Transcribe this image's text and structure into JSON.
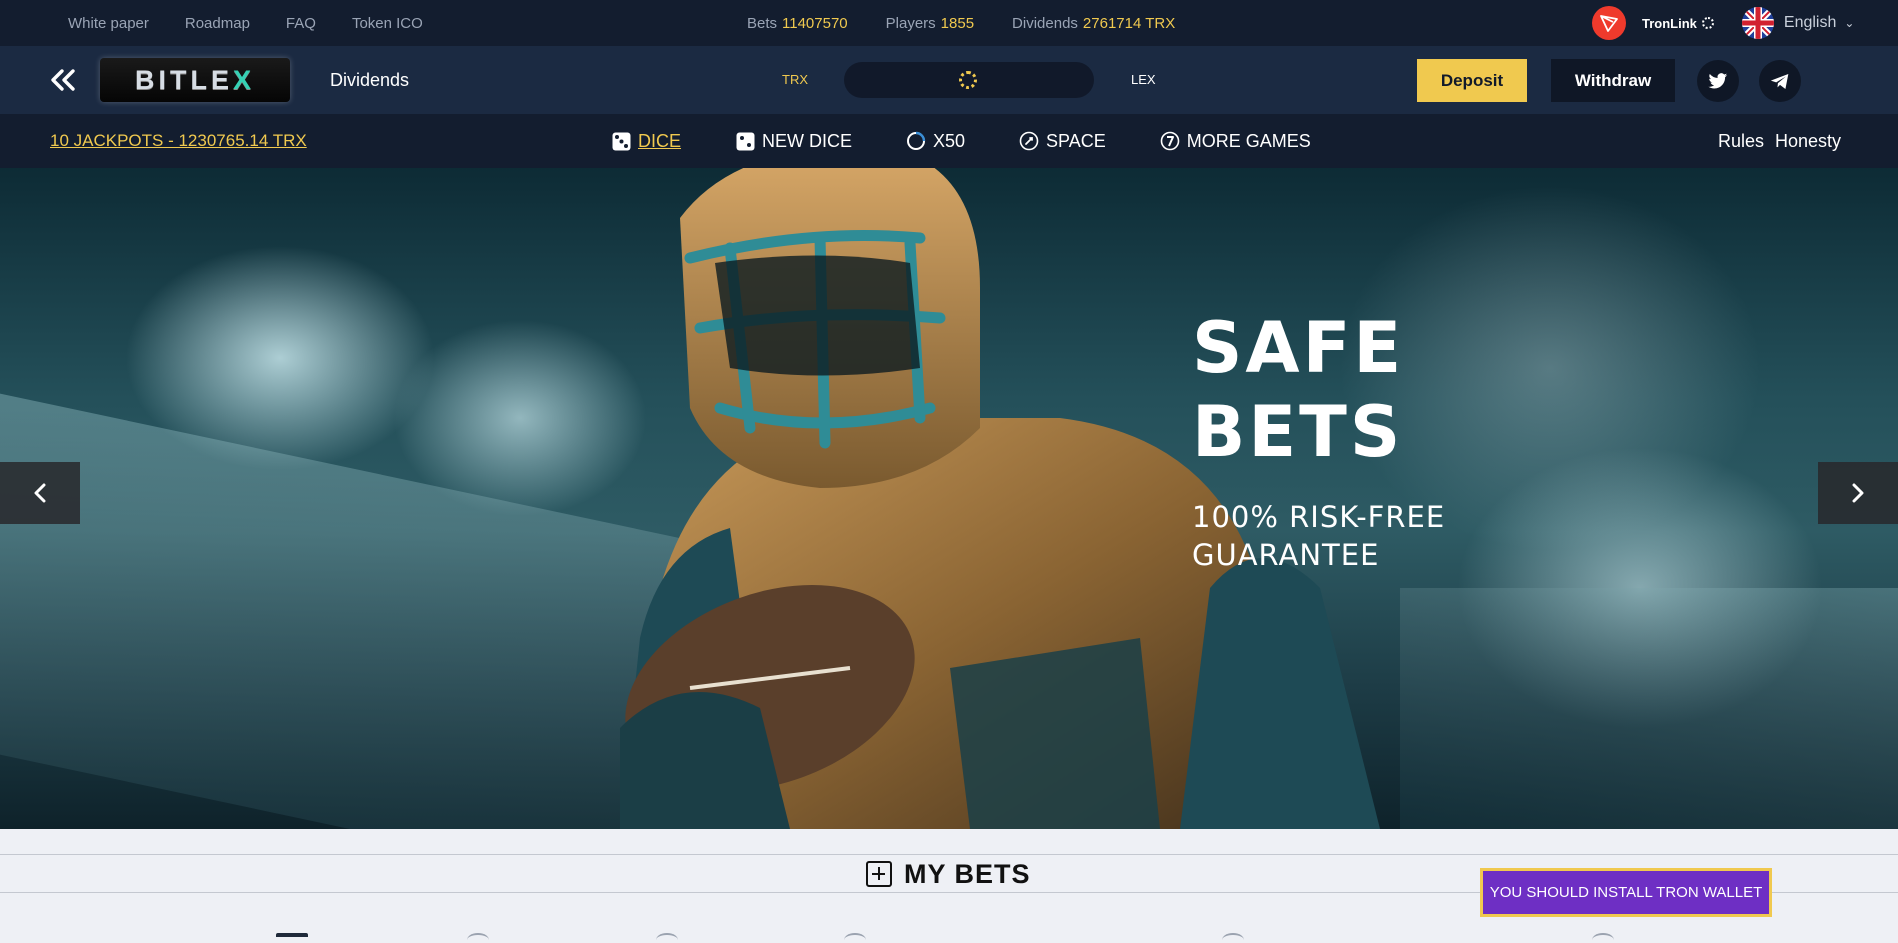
{
  "topbar": {
    "links": [
      "White paper",
      "Roadmap",
      "FAQ",
      "Token ICO"
    ],
    "stats": [
      {
        "label": "Bets",
        "value": "11407570"
      },
      {
        "label": "Players",
        "value": "1855"
      },
      {
        "label": "Dividends",
        "value": "2761714 TRX"
      }
    ],
    "wallet_label": "TronLink",
    "language": "English"
  },
  "header": {
    "logo_text": "BITLE",
    "logo_accent": "X",
    "dividends_label": "Dividends",
    "currency_left": "TRX",
    "currency_right": "LEX",
    "deposit_label": "Deposit",
    "withdraw_label": "Withdraw"
  },
  "nav": {
    "jackpot_text": "10 JACKPOTS - 1230765.14 TRX",
    "games": [
      {
        "label": "DICE",
        "icon": "dice-icon",
        "active": true
      },
      {
        "label": "NEW DICE",
        "icon": "new-dice-icon",
        "active": false
      },
      {
        "label": "X50",
        "icon": "wheel-icon",
        "active": false
      },
      {
        "label": "SPACE",
        "icon": "rocket-icon",
        "active": false
      },
      {
        "label": "MORE GAMES",
        "icon": "seven-icon",
        "active": false
      }
    ],
    "rules_label": "Rules",
    "honesty_label": "Honesty"
  },
  "hero": {
    "title_line1": "SAFE",
    "title_line2": "BETS",
    "subtitle_line1": "100% RISK-FREE",
    "subtitle_line2": "GUARANTEE"
  },
  "bets": {
    "title": "MY BETS",
    "install_notice": "YOU SHOULD INSTALL TRON WALLET"
  },
  "colors": {
    "accent": "#f0c94f",
    "topbar_bg": "#131d2f",
    "header_bg": "#1b2a42",
    "notice_bg": "#6e2fc4"
  }
}
